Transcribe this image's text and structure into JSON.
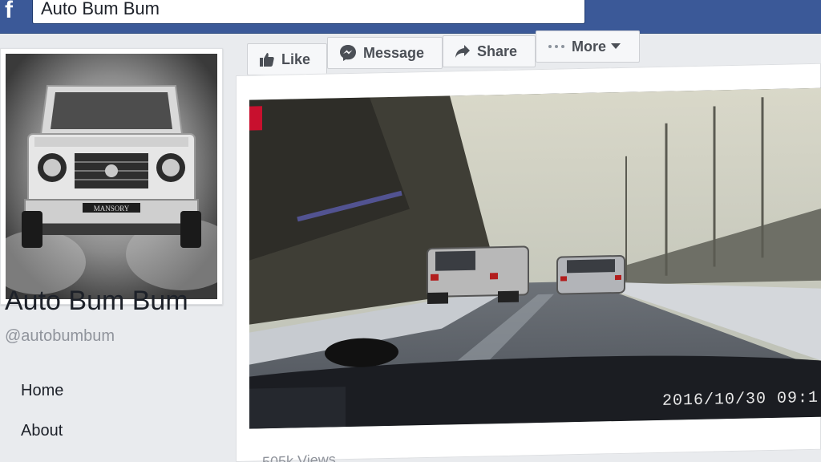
{
  "header": {
    "logo": "f",
    "search_value": "Auto Bum Bum"
  },
  "profile": {
    "name": "Auto Bum Bum",
    "handle": "@autobumbum",
    "picture_plate": "MANSORY"
  },
  "sidebar": {
    "items": [
      {
        "label": "Home"
      },
      {
        "label": "About"
      }
    ]
  },
  "actions": {
    "like_label": "Like",
    "message_label": "Message",
    "share_label": "Share",
    "more_label": "More"
  },
  "post": {
    "video_timestamp": "2016/10/30  09:1",
    "views": "505k Views"
  },
  "colors": {
    "brand": "#3b5998",
    "background": "#e9ebee",
    "button_bg": "#f6f7f9"
  },
  "icons": [
    "thumbs-up-icon",
    "messenger-icon",
    "share-arrow-icon",
    "ellipsis-icon",
    "caret-down-icon"
  ]
}
